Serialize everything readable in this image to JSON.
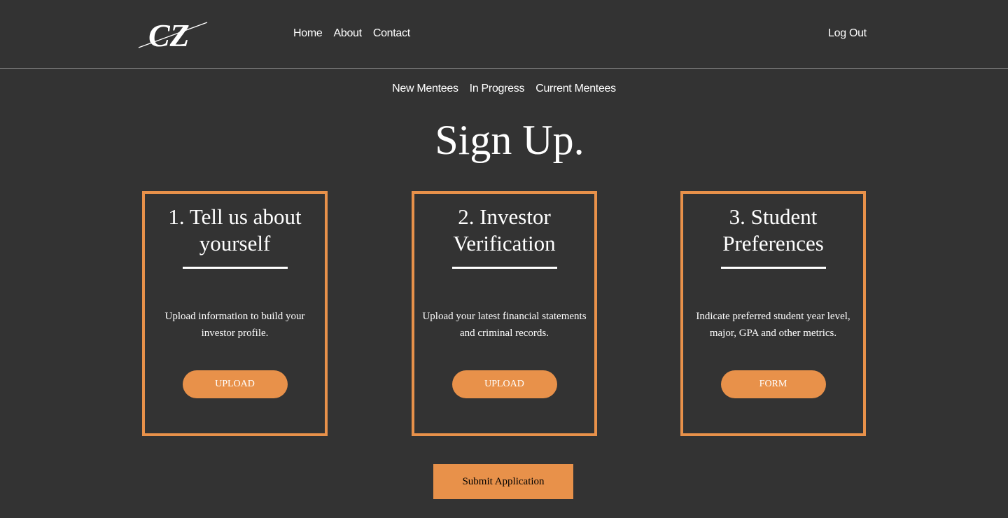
{
  "logo": {
    "text": "CZ"
  },
  "nav": {
    "items": [
      {
        "label": "Home"
      },
      {
        "label": "About"
      },
      {
        "label": "Contact"
      }
    ],
    "logout_label": "Log Out"
  },
  "subnav": {
    "items": [
      {
        "label": "New Mentees"
      },
      {
        "label": "In Progress"
      },
      {
        "label": "Current Mentees"
      }
    ]
  },
  "page": {
    "title": "Sign Up."
  },
  "cards": [
    {
      "title": "1. Tell us about yourself",
      "description": "Upload information to build your investor profile.",
      "button_label": "UPLOAD"
    },
    {
      "title": "2. Investor Verification",
      "description": "Upload your latest financial statements and criminal records.",
      "button_label": "UPLOAD"
    },
    {
      "title": "3. Student Preferences",
      "description": "Indicate preferred student year level, major, GPA and other metrics.",
      "button_label": "FORM"
    }
  ],
  "submit": {
    "label": "Submit Application"
  },
  "colors": {
    "background": "#333333",
    "accent": "#e8914a",
    "text": "#ffffff",
    "divider": "#8a8a8a"
  }
}
